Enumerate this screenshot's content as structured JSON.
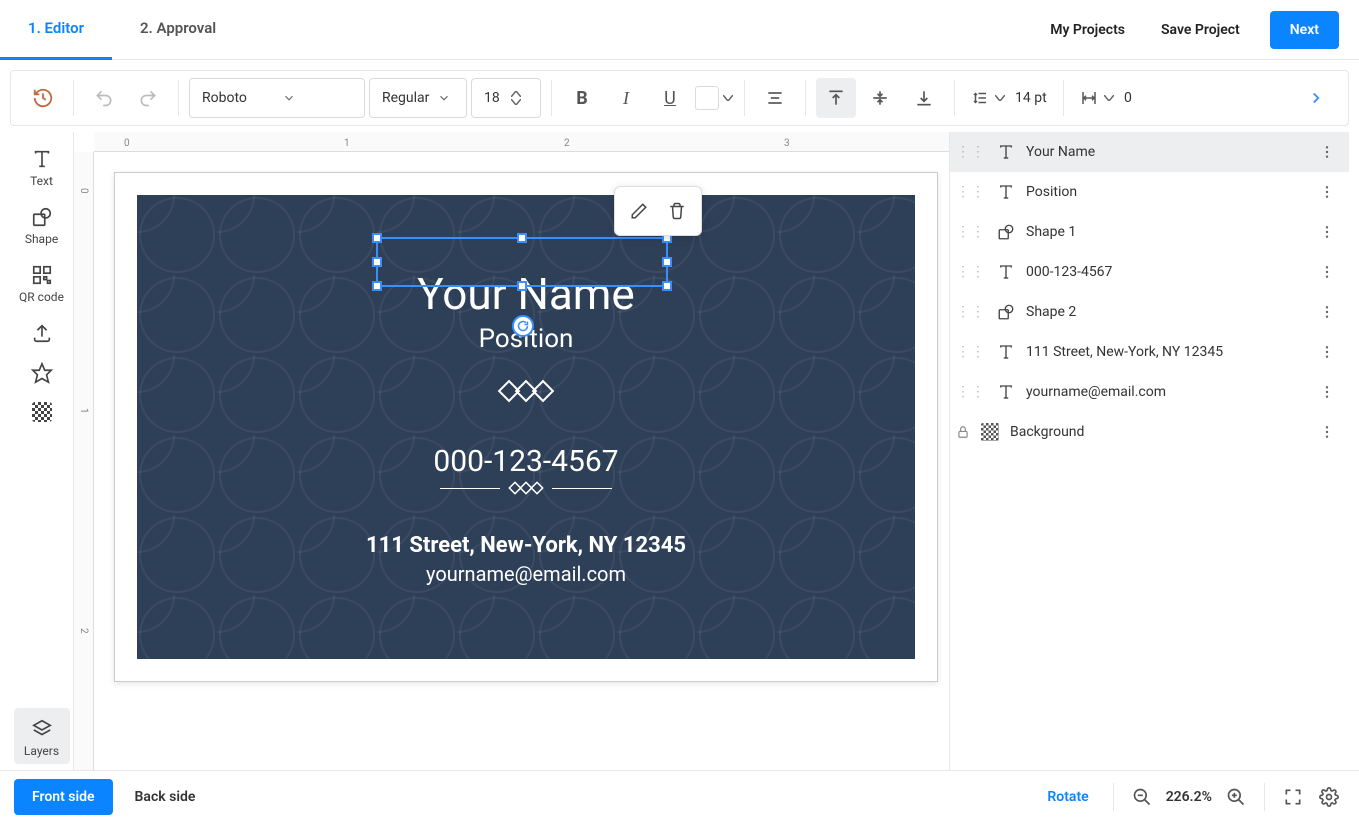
{
  "nav": {
    "tab_editor": "1. Editor",
    "tab_approval": "2. Approval",
    "my_projects": "My Projects",
    "save_project": "Save Project",
    "next": "Next"
  },
  "toolbar": {
    "font_family": "Roboto",
    "font_style": "Regular",
    "font_size": "18",
    "line_height": "14 pt",
    "tracking": "0"
  },
  "left": {
    "text": "Text",
    "shape": "Shape",
    "qrcode": "QR code",
    "layers": "Layers"
  },
  "ruler": {
    "h": [
      "0",
      "1",
      "2",
      "3"
    ],
    "v": [
      "0",
      "1",
      "2"
    ]
  },
  "card": {
    "name": "Your Name",
    "position": "Position",
    "phone": "000-123-4567",
    "address": "111 Street, New-York, NY 12345",
    "email": "yourname@email.com"
  },
  "layers": [
    {
      "name": "Your Name",
      "type": "text",
      "selected": true
    },
    {
      "name": "Position",
      "type": "text"
    },
    {
      "name": "Shape 1",
      "type": "shape"
    },
    {
      "name": "000-123-4567",
      "type": "text"
    },
    {
      "name": "Shape 2",
      "type": "shape"
    },
    {
      "name": "111 Street, New-York, NY 12345",
      "type": "text"
    },
    {
      "name": "yourname@email.com",
      "type": "text"
    },
    {
      "name": "Background",
      "type": "bg",
      "locked": true
    }
  ],
  "bottom": {
    "front": "Front side",
    "back": "Back side",
    "rotate": "Rotate",
    "zoom": "226.2%"
  }
}
